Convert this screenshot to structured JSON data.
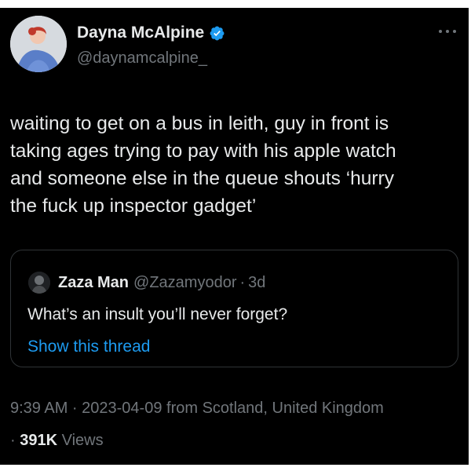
{
  "author": {
    "display_name": "Dayna McAlpine",
    "handle": "@daynamcalpine_",
    "verified": true
  },
  "tweet": {
    "text": "waiting to get on a bus in leith, guy in front is\ntaking ages trying to pay with his apple watch\nand someone else in the queue shouts ‘hurry\nthe fuck up inspector gadget’"
  },
  "quote": {
    "display_name": "Zaza Man",
    "handle": "@Zazamyodor",
    "separator": "·",
    "time": "3d",
    "text": "What’s an insult you’ll never forget?",
    "show_thread": "Show this thread"
  },
  "meta": {
    "line1": "9:39 AM · 2023-04-09 from Scotland, United Kingdom",
    "line2_prefix": "· ",
    "views_count": "391K",
    "views_label": " Views"
  },
  "colors": {
    "background": "#000000",
    "text_primary": "#e7e9ea",
    "text_secondary": "#71767b",
    "link": "#1d9bf0",
    "verified_badge": "#1d9bf0",
    "border": "#2f3336"
  },
  "icons": {
    "verified": "verified-badge-icon",
    "more": "more-options-icon"
  }
}
